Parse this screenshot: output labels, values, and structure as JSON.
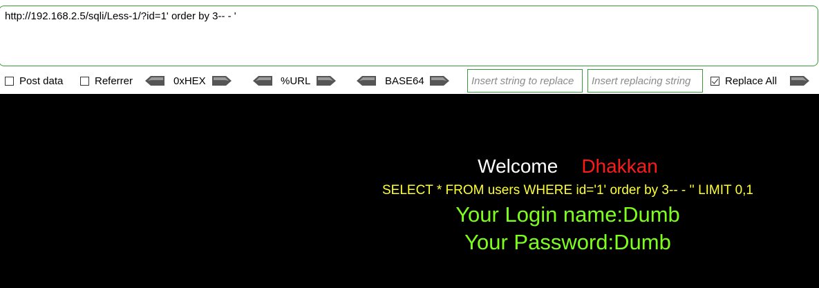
{
  "url_field": {
    "value": "http://192.168.2.5/sqli/Less-1/?id=1' order by 3-- - '"
  },
  "toolbar": {
    "post_data_label": "Post data",
    "post_data_checked": false,
    "referrer_label": "Referrer",
    "referrer_checked": false,
    "hex_label": "0xHEX",
    "url_label": "%URL",
    "base64_label": "BASE64",
    "replace_from_placeholder": "Insert string to replace",
    "replace_to_placeholder": "Insert replacing string",
    "replace_all_label": "Replace All",
    "replace_all_checked": true
  },
  "page": {
    "welcome": "Welcome",
    "name": "Dhakkan",
    "query": "SELECT * FROM users WHERE id='1' order by 3-- - '' LIMIT 0,1",
    "login": "Your Login name:Dumb",
    "password": "Your Password:Dumb"
  },
  "colors": {
    "background": "#000000",
    "welcome": "#ffffff",
    "name": "#ff1a1a",
    "query": "#ffff33",
    "result": "#7cff1a",
    "field_border": "#3a9a3a"
  }
}
